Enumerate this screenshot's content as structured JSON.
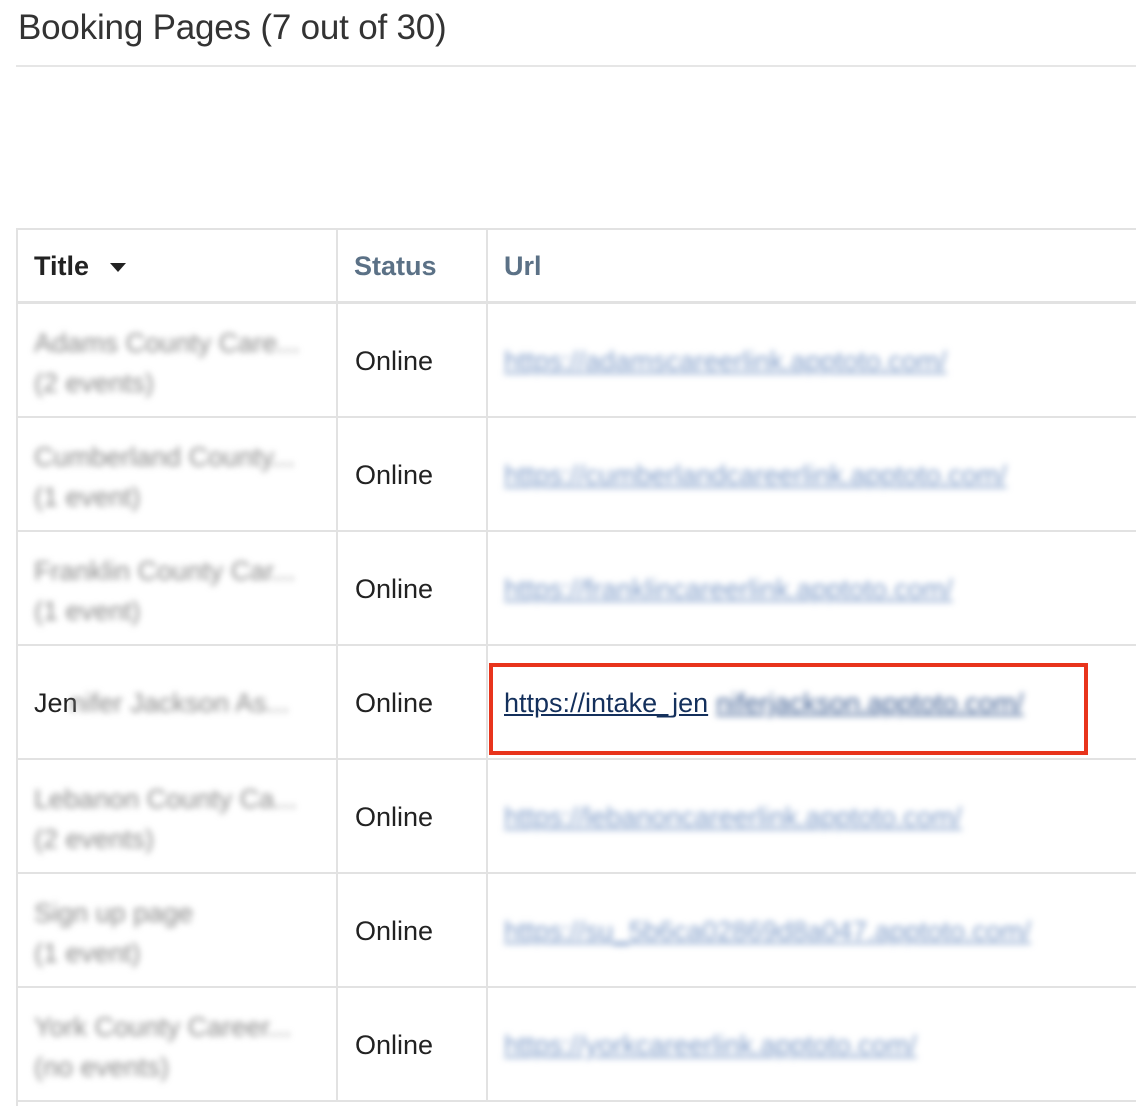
{
  "page": {
    "title": "Booking Pages (7 out of 30)"
  },
  "table": {
    "columns": {
      "title": "Title",
      "status": "Status",
      "url": "Url"
    },
    "sort_icon": "caret-down-icon",
    "rows": [
      {
        "title": "Adams County Care...",
        "subtitle": "(2 events)",
        "status": "Online",
        "url": "https://adamscareerlink.apptoto.com/"
      },
      {
        "title": "Cumberland County...",
        "subtitle": "(1 event)",
        "status": "Online",
        "url": "https://cumberlandcareerlink.apptoto.com/"
      },
      {
        "title": "Franklin County Car...",
        "subtitle": "(1 event)",
        "status": "Online",
        "url": "https://franklincareerlink.apptoto.com/"
      },
      {
        "title_visible": "Jen",
        "title_blurred": "nifer Jackson As...",
        "status": "Online",
        "url_visible": "https://intake_jen",
        "url_blurred": "niferjackson.apptoto.com/"
      },
      {
        "title": "Lebanon County Ca...",
        "subtitle": "(2 events)",
        "status": "Online",
        "url": "https://lebanoncareerlink.apptoto.com/"
      },
      {
        "title": "Sign up page",
        "subtitle": "(1 event)",
        "status": "Online",
        "url": "https://su_5b6ca02869d8a047.apptoto.com/"
      },
      {
        "title": "York County Career...",
        "subtitle": "(no events)",
        "status": "Online",
        "url": "https://yorkcareerlink.apptoto.com/"
      }
    ]
  },
  "colors": {
    "header_accent": "#5b7186",
    "link": "#14305c",
    "highlight": "#e8341c"
  }
}
